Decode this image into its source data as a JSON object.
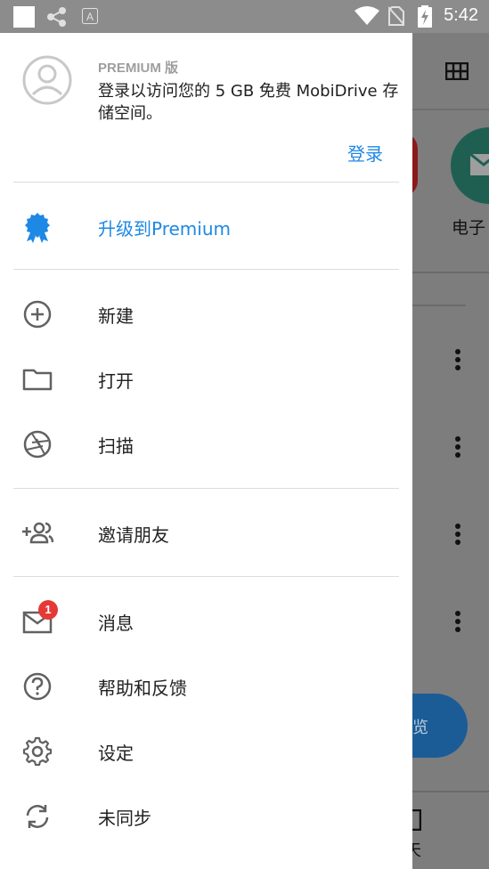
{
  "status_bar": {
    "time": "5:42"
  },
  "account": {
    "premium_tag": "PREMIUM 版",
    "description": "登录以访问您的 5 GB 免费 MobiDrive 存储空间。",
    "login_label": "登录"
  },
  "upgrade": {
    "label": "升级到Premium"
  },
  "menu": {
    "new_label": "新建",
    "open_label": "打开",
    "scan_label": "扫描",
    "invite_label": "邀请朋友",
    "messages_label": "消息",
    "messages_badge": "1",
    "help_label": "帮助和反馈",
    "settings_label": "设定",
    "unsync_label": "未同步"
  },
  "background_app": {
    "email_label": "电子",
    "fab_label": "览",
    "bottom_tab_label": "天"
  },
  "colors": {
    "accent": "#1E88E5",
    "status_bar": "#8c8c8c",
    "scrim": "#7d7d7d",
    "badge": "#e53935"
  }
}
